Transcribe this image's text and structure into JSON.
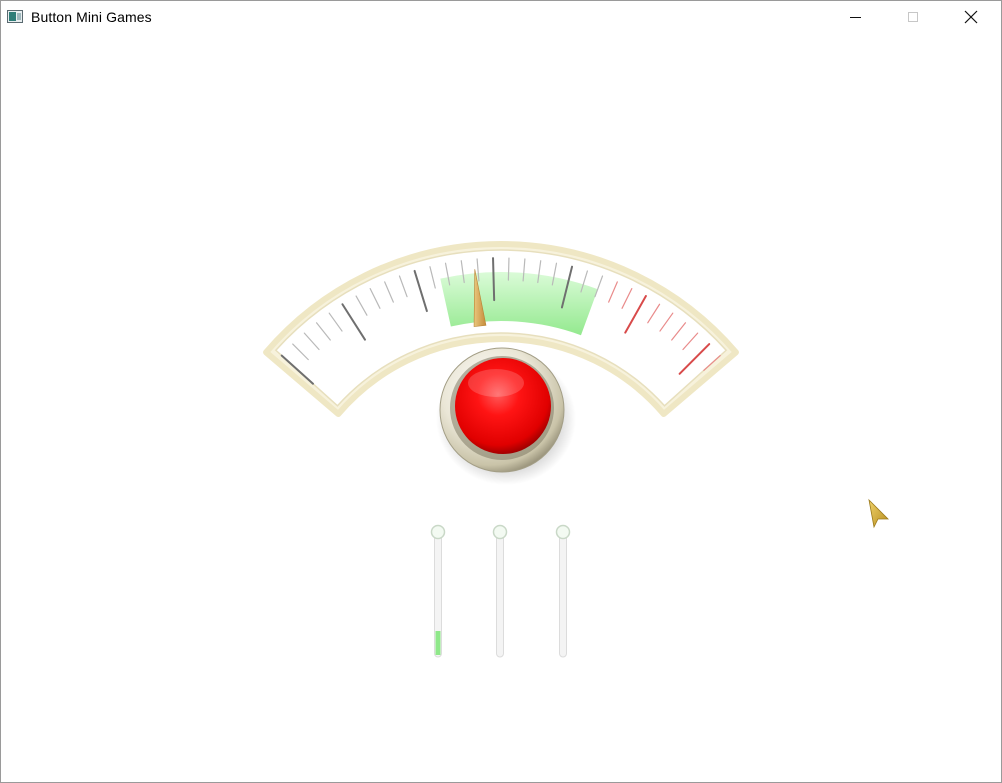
{
  "window": {
    "title": "Button Mini Games",
    "app_icon": "app-window-icon",
    "controls": [
      {
        "name": "minimize",
        "icon": "minimize-icon"
      },
      {
        "name": "maximize",
        "icon": "maximize-icon",
        "enabled": false
      },
      {
        "name": "close",
        "icon": "close-icon"
      }
    ]
  },
  "game": {
    "gauge": {
      "needle_fraction": 0.445,
      "zones": [
        {
          "name": "green-zone",
          "from": 0.37,
          "to": 0.71,
          "color": "#9ff09a"
        },
        {
          "name": "red-zone",
          "from": 0.71,
          "to": 1.0,
          "color": "#e05555"
        }
      ],
      "major_ticks": 6,
      "minor_per_major": 4
    },
    "button": {
      "color": "#ff0000",
      "icon": "red-push-button"
    },
    "sliders": [
      {
        "name": "slider-1",
        "level": 0.2,
        "fill_color": "#8fe88a"
      },
      {
        "name": "slider-2",
        "level": 0.0,
        "fill_color": "#8fe88a"
      },
      {
        "name": "slider-3",
        "level": 0.0,
        "fill_color": "#8fe88a"
      }
    ],
    "cursor": {
      "icon": "arrow-cursor-icon",
      "color": "#d8b33a"
    }
  }
}
